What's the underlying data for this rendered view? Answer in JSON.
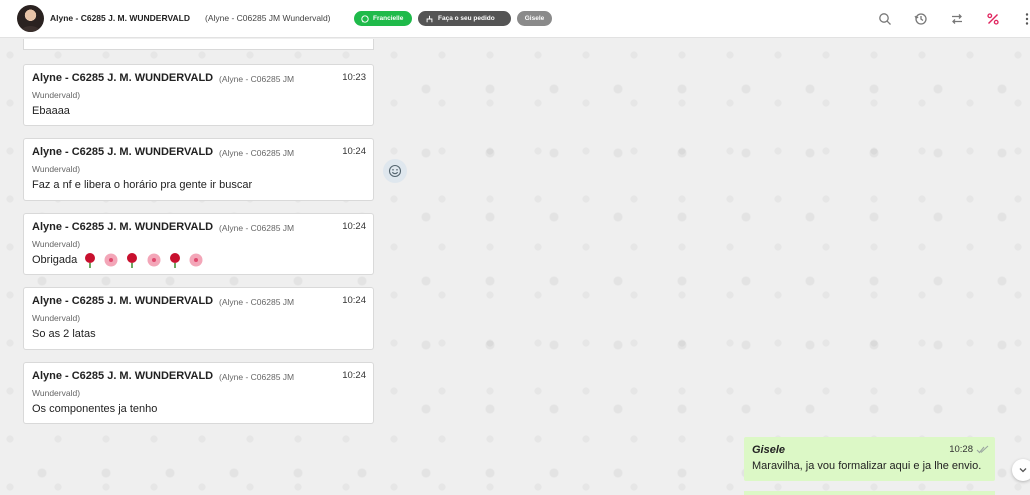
{
  "header": {
    "contact_name": "Alyne - C6285 J. M. WUNDERVALD",
    "contact_sub": "(Alyne - C06285 JM Wundervald)",
    "tag_whatsapp": "Francielle",
    "tag_order": "Faça o seu pedido",
    "tag_agent": "Gisele",
    "icons": [
      "search-icon",
      "history-icon",
      "transfer-icon",
      "percent-icon",
      "more-icon"
    ],
    "accent_color": "#e0245e"
  },
  "messages": [
    {
      "sender": "Alyne - C6285 J. M. WUNDERVALD",
      "alias": "(Alyne - C06285 JM",
      "alias2": "Wundervald)",
      "time": "10:23",
      "text": "Ebaaaa"
    },
    {
      "sender": "Alyne - C6285 J. M. WUNDERVALD",
      "alias": "(Alyne - C06285 JM",
      "alias2": "Wundervald)",
      "time": "10:24",
      "text": "Faz a nf e libera o horário pra gente ir buscar"
    },
    {
      "sender": "Alyne - C6285 J. M. WUNDERVALD",
      "alias": "(Alyne - C06285 JM",
      "alias2": "Wundervald)",
      "time": "10:24",
      "text": "Obrigada"
    },
    {
      "sender": "Alyne - C6285 J. M. WUNDERVALD",
      "alias": "(Alyne - C06285 JM",
      "alias2": "Wundervald)",
      "time": "10:24",
      "text": "So as 2 latas"
    },
    {
      "sender": "Alyne - C6285 J. M. WUNDERVALD",
      "alias": "(Alyne - C06285 JM",
      "alias2": "Wundervald)",
      "time": "10:24",
      "text": "Os componentes ja tenho"
    }
  ],
  "outgoing": {
    "sender": "Gisele",
    "time": "10:28",
    "text": "Maravilha, ja vou formalizar aqui e ja lhe envio."
  }
}
